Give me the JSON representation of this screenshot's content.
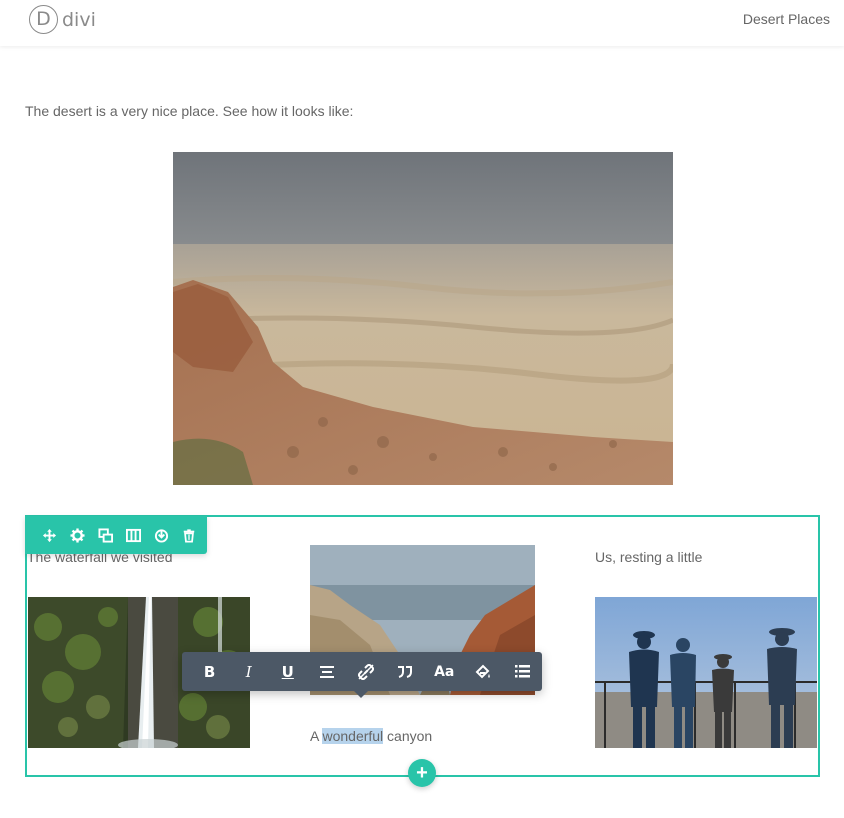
{
  "header": {
    "logo_letter": "D",
    "logo_text": "divi",
    "nav_link": "Desert Places"
  },
  "content": {
    "intro": "The desert is a very nice place. See how it looks like:",
    "col1_text": "The waterfall we visited",
    "col3_text": "Us, resting a little",
    "canyon_caption_before": "A ",
    "canyon_caption_highlight": "wonderful",
    "canyon_caption_after": " canyon"
  },
  "module_toolbar": {
    "icons": [
      "move-icon",
      "gear-icon",
      "duplicate-icon",
      "columns-icon",
      "save-icon",
      "trash-icon"
    ]
  },
  "text_toolbar": {
    "bold": "B",
    "italic": "I",
    "underline": "U",
    "font": "Aa",
    "icons": [
      "bold-icon",
      "italic-icon",
      "underline-icon",
      "align-icon",
      "link-icon",
      "quote-icon",
      "font-icon",
      "color-icon",
      "list-icon"
    ]
  },
  "add_button": "+",
  "colors": {
    "accent": "#29c4a9",
    "toolbar_dark": "#4c5866",
    "highlight": "#b6d3ec",
    "text": "#666666"
  }
}
